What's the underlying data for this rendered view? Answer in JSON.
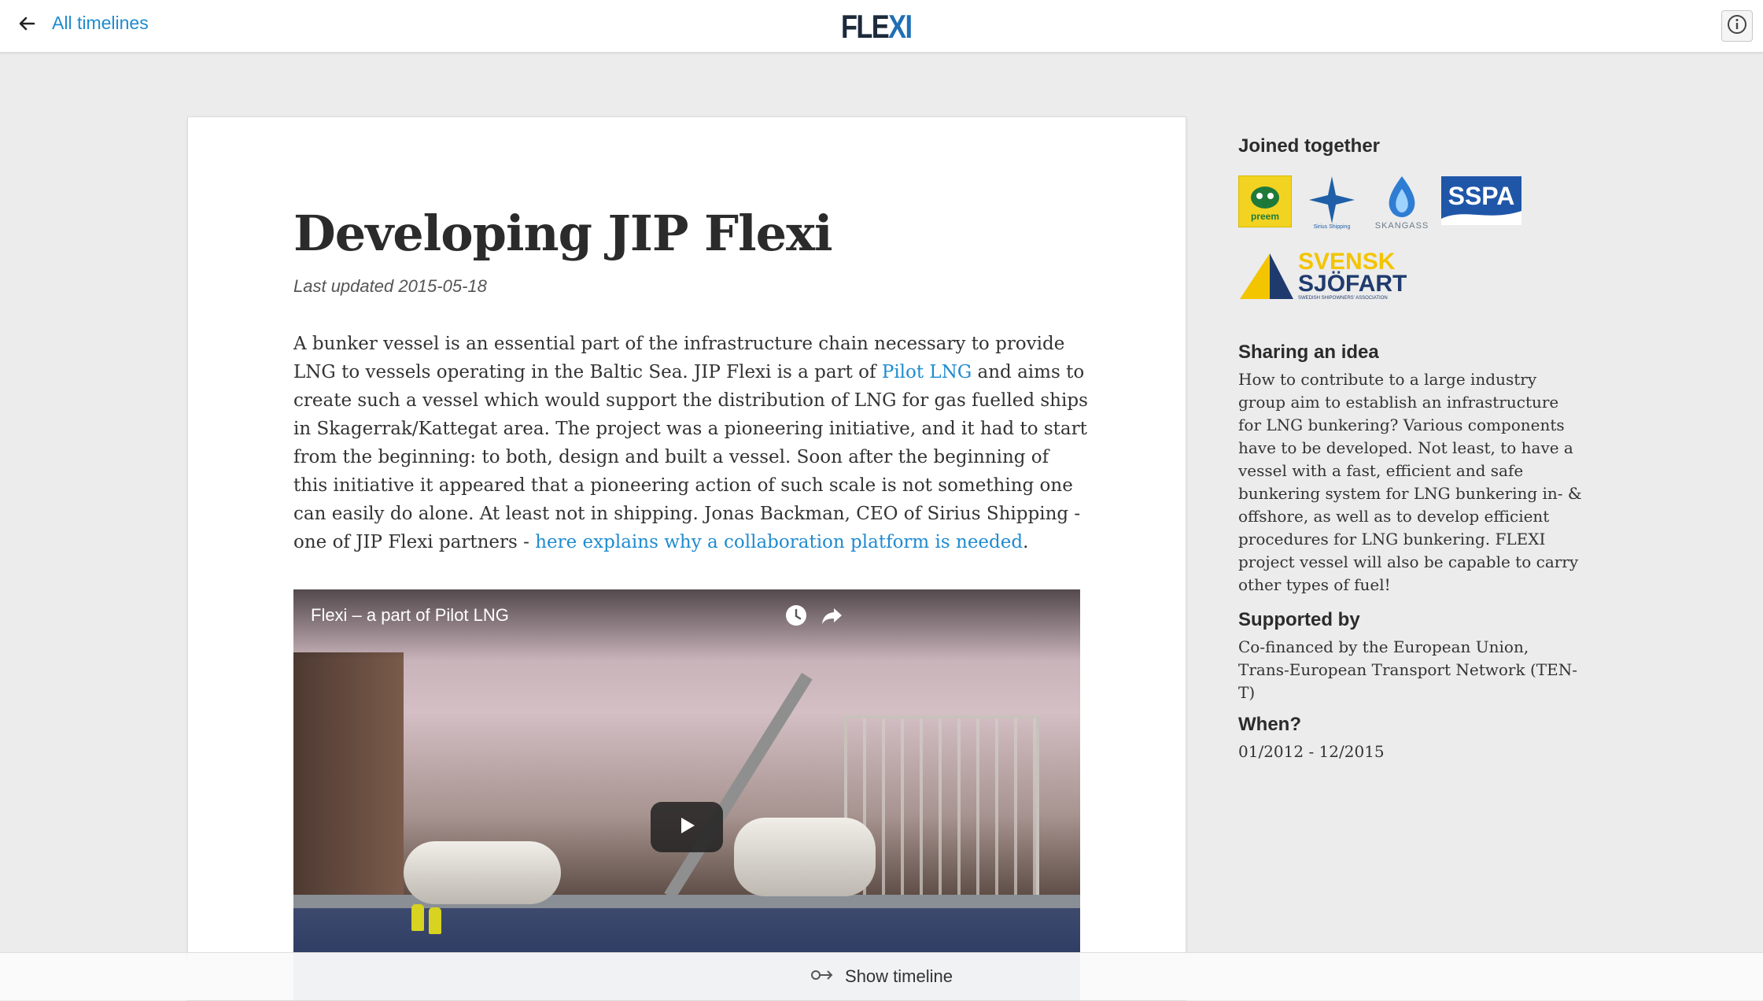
{
  "header": {
    "back_label": "All timelines",
    "logo_part1": "FLE",
    "logo_part2": "XI"
  },
  "article": {
    "title": "Developing JIP Flexi",
    "updated": "Last updated 2015-05-18",
    "body_1": "A bunker vessel is an essential part of the infrastructure chain necessary to provide LNG to vessels operating in the Baltic Sea. JIP Flexi is a part of ",
    "link_pilot": "Pilot LNG",
    "body_2": " and aims to create such a vessel which would support the distribution of LNG for gas fuelled ships in Skagerrak/Kattegat area. The project was a pioneering initiative, and it had to start from the beginning: to both, design and built a vessel. Soon after the beginning of this initiative it appeared that a pioneering action of such scale is not something one can easily do alone. At least not in shipping. Jonas Backman, CEO of Sirius Shipping - one of JIP Flexi partners - ",
    "link_here": "here explains why a collaboration platform is needed",
    "body_3": "."
  },
  "video": {
    "title": "Flexi – a part of Pilot LNG"
  },
  "sidebar": {
    "joined_heading": "Joined together",
    "partners": {
      "preem": "preem",
      "sirius": "Sirius Shipping",
      "skangass": "SKANGASS",
      "sspa": "SSPA",
      "svensk_1": "SVENSK",
      "svensk_2": "SJÖFART",
      "svensk_3": "SWEDISH SHIPOWNERS' ASSOCIATION"
    },
    "idea_heading": "Sharing an idea",
    "idea_text": "How to contribute to a large industry group aim to establish an infrastructure for LNG bunkering? Various components have to be developed. Not least, to have a vessel with a fast, efficient and safe bunkering system for LNG bunkering in- & offshore, as well as to develop efficient procedures for LNG bunkering. FLEXI project vessel will also be capable to carry other types of fuel!",
    "supported_heading": "Supported by",
    "supported_text": "Co-financed by the European Union, Trans-European Transport Network (TEN-T)",
    "when_heading": "When?",
    "when_text": "01/2012 - 12/2015"
  },
  "footer": {
    "show_timeline": "Show timeline"
  },
  "colors": {
    "link": "#1f8bd0",
    "logo_dark": "#1c2a3a",
    "logo_blue": "#1f6fb5",
    "background": "#ececec"
  },
  "icons": [
    "arrow-left-icon",
    "info-icon",
    "clock-icon",
    "share-icon",
    "play-icon",
    "timeline-icon"
  ]
}
